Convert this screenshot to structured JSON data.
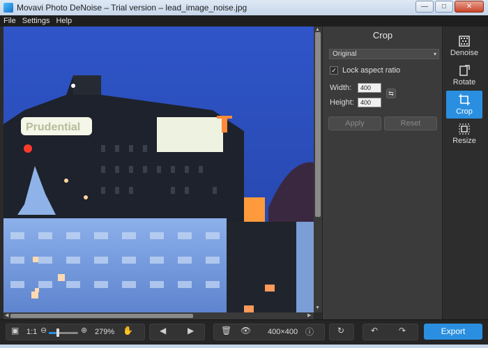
{
  "window": {
    "title": "Movavi Photo DeNoise – Trial version – lead_image_noise.jpg"
  },
  "menu": [
    "File",
    "Settings",
    "Help"
  ],
  "crop_panel": {
    "title": "Crop",
    "aspect_select": "Original",
    "lock_aspect_label": "Lock aspect ratio",
    "lock_aspect_checked": true,
    "width_label": "Width:",
    "width_value": "400",
    "height_label": "Height:",
    "height_value": "400",
    "apply_label": "Apply",
    "reset_label": "Reset"
  },
  "tools": [
    {
      "label": "Denoise",
      "icon": "denoise-icon",
      "active": false
    },
    {
      "label": "Rotate",
      "icon": "rotate-icon",
      "active": false
    },
    {
      "label": "Crop",
      "icon": "crop-icon",
      "active": true
    },
    {
      "label": "Resize",
      "icon": "resize-icon",
      "active": false
    }
  ],
  "bottombar": {
    "ratio_label": "1:1",
    "zoom_value": "279%",
    "zoom_level_fraction": 0.3,
    "dimensions": "400×400",
    "export_label": "Export"
  },
  "image_sign_text": "Prudential",
  "colors": {
    "accent": "#2a8fe0",
    "panel": "#3b3b3b",
    "rail": "#2d2d2d"
  }
}
